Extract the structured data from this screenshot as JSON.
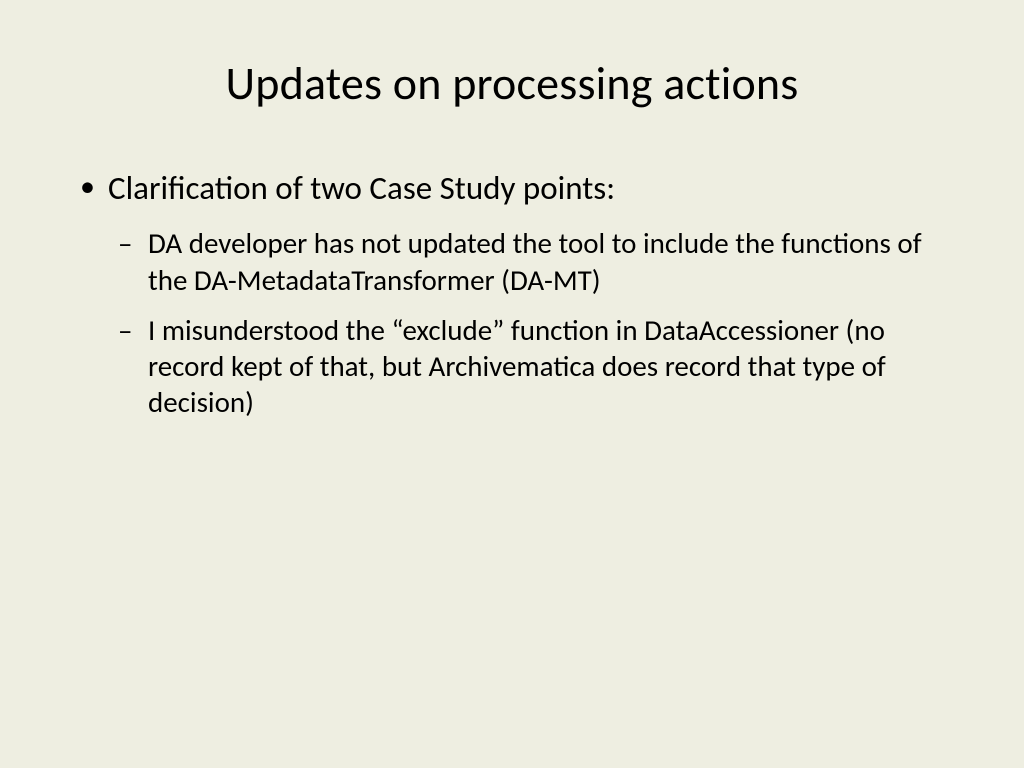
{
  "slide": {
    "title": "Updates on processing actions",
    "bullets": {
      "level1_item1": "Clarification of two Case Study points:",
      "level2_item1": "DA developer has not updated the tool to include the functions of the DA-MetadataTransformer (DA-MT)",
      "level2_item2": "I misunderstood the “exclude” function in DataAccessioner (no record kept of that, but Archivematica does record that type of decision)"
    }
  }
}
